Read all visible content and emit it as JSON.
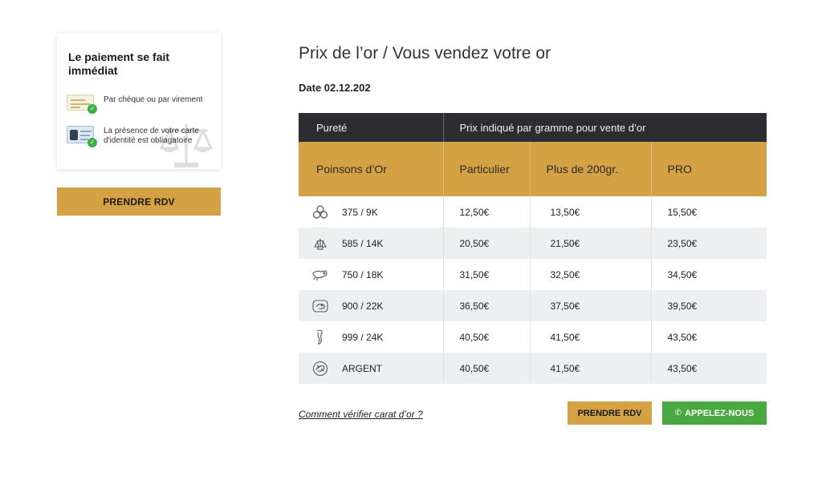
{
  "info_card": {
    "title": "Le paiement se fait immédiat",
    "rows": [
      {
        "icon": "cheque-icon",
        "text": "Par chèque ou par virement"
      },
      {
        "icon": "id-card-icon",
        "text": "La présence de votre carte d'identité est obliagatoire"
      }
    ],
    "decor_icon": "scale-icon"
  },
  "left_button": {
    "label": "PRENDRE RDV"
  },
  "main": {
    "title": "Prix de l’or  / Vous vendez votre or",
    "date": "Date 02.12.202"
  },
  "table": {
    "header_top": {
      "col0": "Pureté",
      "col1": "Prix indiqué par gramme pour vente d’or"
    },
    "header_sub": [
      "Poinsons d’Or",
      "Particulier",
      "Plus de 200gr.",
      "PRO"
    ],
    "rows": [
      {
        "icon": "trefoil-hallmark-icon",
        "purity": "375 / 9K",
        "particulier": "12,50€",
        "plus200": "13,50€",
        "pro": "15,50€"
      },
      {
        "icon": "shell-hallmark-icon",
        "purity": "585 / 14K",
        "particulier": "20,50€",
        "plus200": "21,50€",
        "pro": "23,50€"
      },
      {
        "icon": "horse-head-hallmark-icon",
        "purity": "750 / 18K",
        "particulier": "31,50€",
        "plus200": "32,50€",
        "pro": "34,50€"
      },
      {
        "icon": "eagle-hallmark-icon",
        "purity": "900 / 22K",
        "particulier": "36,50€",
        "plus200": "37,50€",
        "pro": "39,50€"
      },
      {
        "icon": "seahorse-hallmark-icon",
        "purity": "999 / 24K",
        "particulier": "40,50€",
        "plus200": "41,50€",
        "pro": "43,50€"
      },
      {
        "icon": "silver-hallmark-icon",
        "purity": "ARGENT",
        "particulier": "40,50€",
        "plus200": "41,50€",
        "pro": "43,50€"
      }
    ]
  },
  "footer": {
    "link": "Comment vérifier carat d’or ?",
    "rdv_label": "PRENDRE RDV",
    "call_icon": "phone-icon",
    "call_label": "APPELEZ-NOUS"
  },
  "colors": {
    "gold": "#d4a144",
    "dark_header": "#2b2d30",
    "green": "#4aa840",
    "row_alt": "#eeeff1"
  }
}
